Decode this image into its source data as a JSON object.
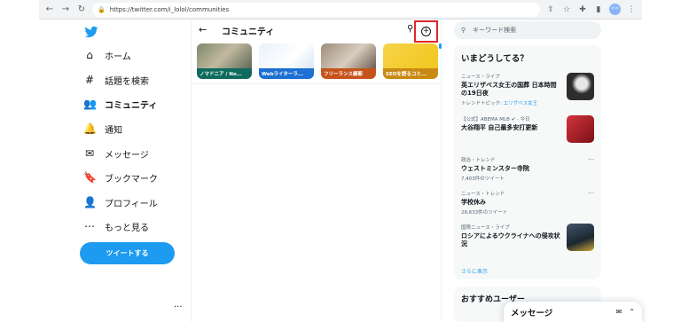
{
  "browser": {
    "url": "https://twitter.com/i_lolol/communities",
    "back_icon": "←",
    "forward_icon": "→",
    "reload_icon": "↻",
    "profile_initials": "ㅇㅇ"
  },
  "nav": {
    "logo": "twitter-bird",
    "items": [
      {
        "label": "ホーム",
        "icon": "⌂"
      },
      {
        "label": "話題を検索",
        "icon": "#"
      },
      {
        "label": "コミュニティ",
        "icon": "👥"
      },
      {
        "label": "通知",
        "icon": "🔔"
      },
      {
        "label": "メッセージ",
        "icon": "✉"
      },
      {
        "label": "ブックマーク",
        "icon": "🔖"
      },
      {
        "label": "プロフィール",
        "icon": "👤"
      },
      {
        "label": "もっと見る",
        "icon": "⋯"
      }
    ],
    "tweet_button": "ツイートする",
    "more_dots": "..."
  },
  "center": {
    "back": "←",
    "title": "コミュニティ",
    "search_icon": "○",
    "create_icon": "+",
    "cards": [
      {
        "label": "ノマドニア / No...",
        "color": "#0e6b5e"
      },
      {
        "label": "Webライターラ...",
        "color": "#1d6fd1"
      },
      {
        "label": "フリーランス顧都",
        "color": "#c5531b"
      },
      {
        "label": "SEOを語るコミ...",
        "color": "#c98a14"
      }
    ]
  },
  "right": {
    "search_placeholder": "キーワード検索",
    "trends_title": "いまどうしてる？",
    "trends": [
      {
        "meta": "ニュース・ライブ",
        "title": "英エリザベス女王の国葬 日本時間の19日夜",
        "sub_prefix": "トレンドトピック: ",
        "sub_link": "エリザベス女王",
        "thumb_color": "#2d2d2d"
      },
      {
        "meta": "【公式】ABEMA MLB ✔ · 今日",
        "title": "大谷翔平 自己最多安打更新",
        "sub_prefix": "",
        "sub_link": "",
        "thumb_color": "#b3262e"
      },
      {
        "meta": "政治・トレンド",
        "title": "ウェストミンスター寺院",
        "sub_prefix": "7,403件のツイート",
        "sub_link": "",
        "thumb_color": ""
      },
      {
        "meta": "ニュース・トレンド",
        "title": "学校休み",
        "sub_prefix": "28,633件のツイート",
        "sub_link": "",
        "thumb_color": ""
      },
      {
        "meta": "国際ニュース・ライブ",
        "title": "ロシアによるウクライナへの侵攻状況",
        "sub_prefix": "",
        "sub_link": "",
        "thumb_color": "#2f3d4a"
      }
    ],
    "show_more": "さらに表示",
    "recommend_title": "おすすめユーザー",
    "messages_title": "メッセージ"
  }
}
